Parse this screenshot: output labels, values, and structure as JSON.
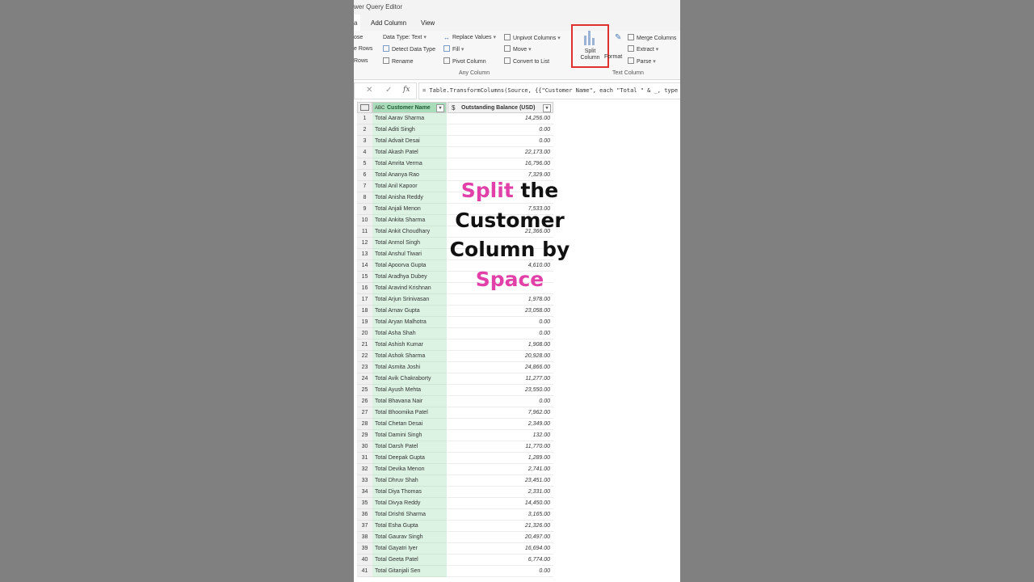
{
  "window": {
    "title": "wer Query Editor"
  },
  "tabs": {
    "home_fragment": "a",
    "add_column": "Add Column",
    "view": "View"
  },
  "ribbon": {
    "left_cut": [
      "ose",
      "e Rows",
      "Rows"
    ],
    "data_type": "Data Type: Text",
    "detect_data_type": "Detect Data Type",
    "rename": "Rename",
    "replace_values": "Replace Values",
    "fill": "Fill",
    "pivot_column": "Pivot Column",
    "unpivot_columns": "Unpivot Columns",
    "move": "Move",
    "convert_to_list": "Convert to List",
    "any_column_group": "Any Column",
    "split_column_line1": "Split",
    "split_column_line2": "Column",
    "format": "Format",
    "merge_columns": "Merge Columns",
    "extract": "Extract",
    "parse": "Parse",
    "text_column_group": "Text Column",
    "highlight_color": "#e03030"
  },
  "formula_bar": {
    "cancel": "✕",
    "confirm": "✓",
    "fx": "fx",
    "formula": "= Table.TransformColumns(Source, {{\"Customer Name\", each \"Total \" & _, type text}})"
  },
  "table": {
    "columns": [
      "Customer Name",
      "Outstanding Balance (USD)"
    ],
    "type_icons": [
      "ABC",
      "$"
    ],
    "rows": [
      {
        "n": "1",
        "name": "Total Aarav Sharma",
        "bal": "14,256.00"
      },
      {
        "n": "2",
        "name": "Total Aditi Singh",
        "bal": "0.00"
      },
      {
        "n": "3",
        "name": "Total Advait Desai",
        "bal": "0.00"
      },
      {
        "n": "4",
        "name": "Total Akash Patel",
        "bal": "22,173.00"
      },
      {
        "n": "5",
        "name": "Total Amrita Verma",
        "bal": "16,796.00"
      },
      {
        "n": "6",
        "name": "Total Ananya Rao",
        "bal": "7,329.00"
      },
      {
        "n": "7",
        "name": "Total Anil Kapoor",
        "bal": ""
      },
      {
        "n": "8",
        "name": "Total Anisha Reddy",
        "bal": ""
      },
      {
        "n": "9",
        "name": "Total Anjali Menon",
        "bal": "7,533.00"
      },
      {
        "n": "10",
        "name": "Total Ankita Sharma",
        "bal": ""
      },
      {
        "n": "11",
        "name": "Total Ankit Choudhary",
        "bal": "21,366.00"
      },
      {
        "n": "12",
        "name": "Total Anmol Singh",
        "bal": ""
      },
      {
        "n": "13",
        "name": "Total Anshul Tiwari",
        "bal": ""
      },
      {
        "n": "14",
        "name": "Total Apoorva Gupta",
        "bal": "4,610.00"
      },
      {
        "n": "15",
        "name": "Total Aradhya Dubey",
        "bal": ""
      },
      {
        "n": "16",
        "name": "Total Aravind Krishnan",
        "bal": ""
      },
      {
        "n": "17",
        "name": "Total Arjun Srinivasan",
        "bal": "1,978.00"
      },
      {
        "n": "18",
        "name": "Total Arnav Gupta",
        "bal": "23,058.00"
      },
      {
        "n": "19",
        "name": "Total Aryan Malhotra",
        "bal": "0.00"
      },
      {
        "n": "20",
        "name": "Total Asha Shah",
        "bal": "0.00"
      },
      {
        "n": "21",
        "name": "Total Ashish Kumar",
        "bal": "1,908.00"
      },
      {
        "n": "22",
        "name": "Total Ashok Sharma",
        "bal": "20,928.00"
      },
      {
        "n": "23",
        "name": "Total Asmita Joshi",
        "bal": "24,866.00"
      },
      {
        "n": "24",
        "name": "Total Avik Chakraborty",
        "bal": "11,277.00"
      },
      {
        "n": "25",
        "name": "Total Ayush Mehta",
        "bal": "23,550.00"
      },
      {
        "n": "26",
        "name": "Total Bhavana Nair",
        "bal": "0.00"
      },
      {
        "n": "27",
        "name": "Total Bhoomika Patel",
        "bal": "7,962.00"
      },
      {
        "n": "28",
        "name": "Total Chetan Desai",
        "bal": "2,349.00"
      },
      {
        "n": "29",
        "name": "Total Damini Singh",
        "bal": "132.00"
      },
      {
        "n": "30",
        "name": "Total Darsh Patel",
        "bal": "11,770.00"
      },
      {
        "n": "31",
        "name": "Total Deepak Gupta",
        "bal": "1,289.00"
      },
      {
        "n": "32",
        "name": "Total Devika Menon",
        "bal": "2,741.00"
      },
      {
        "n": "33",
        "name": "Total Dhruv Shah",
        "bal": "23,451.00"
      },
      {
        "n": "34",
        "name": "Total Diya Thomas",
        "bal": "2,331.00"
      },
      {
        "n": "35",
        "name": "Total Divya Reddy",
        "bal": "14,450.00"
      },
      {
        "n": "36",
        "name": "Total Drishti Sharma",
        "bal": "3,165.00"
      },
      {
        "n": "37",
        "name": "Total Esha Gupta",
        "bal": "21,326.00"
      },
      {
        "n": "38",
        "name": "Total Gaurav Singh",
        "bal": "20,497.00"
      },
      {
        "n": "39",
        "name": "Total Gayatri Iyer",
        "bal": "16,694.00"
      },
      {
        "n": "40",
        "name": "Total Geeta Patel",
        "bal": "6,774.00"
      },
      {
        "n": "41",
        "name": "Total Gitanjali Sen",
        "bal": "0.00"
      }
    ]
  },
  "overlay": {
    "line1_pink": "Split",
    "line1_rest": " the",
    "line2": "Customer",
    "line3": "Column by",
    "line4_pink": "Space",
    "pink_color": "#e040a8"
  }
}
